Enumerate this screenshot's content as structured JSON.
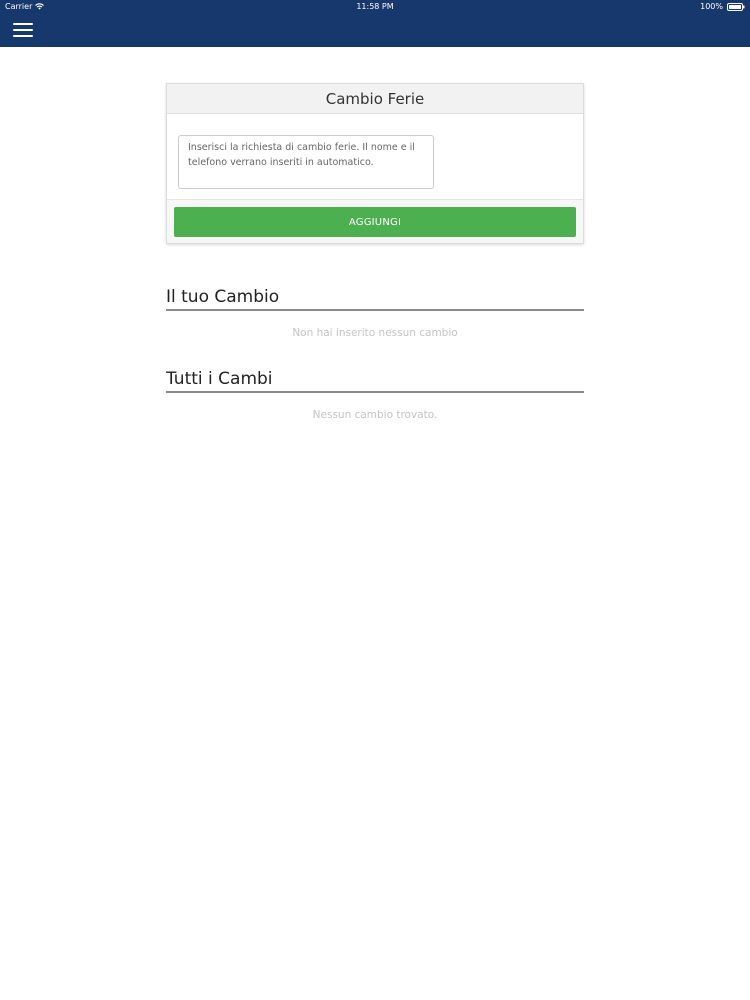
{
  "status_bar": {
    "carrier": "Carrier",
    "time": "11:58 PM",
    "battery": "100%"
  },
  "header": {
    "menu_icon": "hamburger-menu-icon",
    "background_color": "#16386c"
  },
  "form": {
    "title": "Cambio Ferie",
    "input_placeholder": "Inserisci la richiesta di cambio ferie. Il nome e il telefono verrano inseriti in automatico.",
    "input_value": "",
    "submit_label": "AGGIUNGI",
    "submit_color": "#4caf50"
  },
  "my_changes": {
    "title": "Il tuo Cambio",
    "empty_message": "Non hai inserito nessun cambio"
  },
  "all_changes": {
    "title": "Tutti i Cambi",
    "empty_message": "Nessun cambio trovato."
  }
}
